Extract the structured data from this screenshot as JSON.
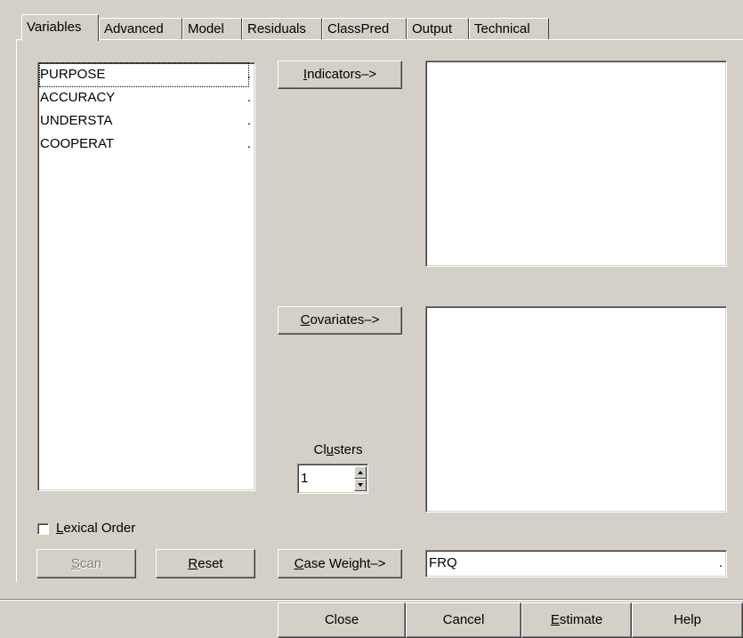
{
  "tabs": [
    {
      "label": "Variables",
      "active": true
    },
    {
      "label": "Advanced"
    },
    {
      "label": "Model"
    },
    {
      "label": "Residuals"
    },
    {
      "label": "ClassPred"
    },
    {
      "label": "Output"
    },
    {
      "label": "Technical"
    }
  ],
  "variables": {
    "items": [
      {
        "label": "PURPOSE",
        "mark": "."
      },
      {
        "label": "ACCURACY",
        "mark": "."
      },
      {
        "label": "UNDERSTA",
        "mark": "."
      },
      {
        "label": "COOPERAT",
        "mark": "."
      }
    ]
  },
  "buttons": {
    "indicators": {
      "accel": "I",
      "rest": "ndicators–>"
    },
    "covariates": {
      "accel": "C",
      "rest": "ovariates–>"
    },
    "case_weight": {
      "accel": "C",
      "rest": "ase Weight–>"
    },
    "scan": {
      "accel": "S",
      "rest": "can"
    },
    "reset": {
      "accel": "R",
      "rest": "eset"
    }
  },
  "clusters": {
    "label_pre": "Cl",
    "label_accel": "u",
    "label_post": "sters",
    "value": "1"
  },
  "lexical_order": {
    "accel": "L",
    "rest": "exical Order",
    "checked": false
  },
  "case_weight_value": "FRQ",
  "case_weight_mark": ".",
  "bottom": {
    "close": "Close",
    "cancel": "Cancel",
    "estimate_accel": "E",
    "estimate_rest": "stimate",
    "help": "Help"
  }
}
